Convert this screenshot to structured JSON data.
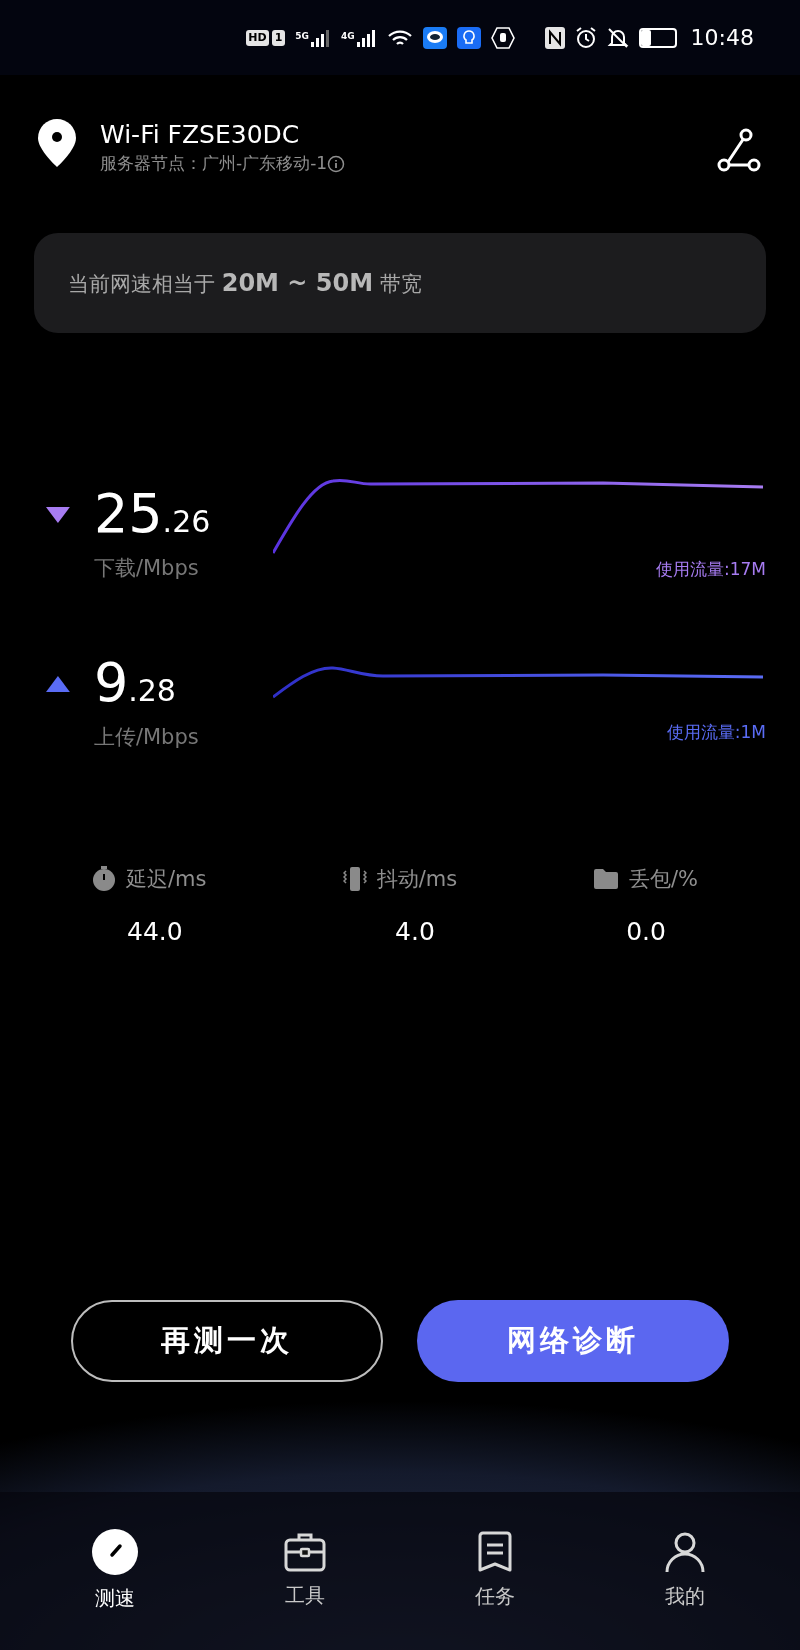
{
  "status_bar": {
    "hd": "HD",
    "sim": "1",
    "net1": "5G",
    "net2": "4G",
    "time": "10:48",
    "battery": {
      "level": 0.3
    }
  },
  "header": {
    "title": "Wi-Fi FZSE30DC",
    "subtitle": "服务器节点：广州-广东移动-1"
  },
  "bandwidth_card": {
    "text": "当前网速相当于 **20M ~ 50M** 带宽"
  },
  "speeds": [
    {
      "kind": "download",
      "int": "25",
      "dec": ".26",
      "unit": "下载/Mbps",
      "usage": "使用流量:17M",
      "color": "#a77cf2"
    },
    {
      "kind": "upload",
      "int": "9",
      "dec": ".28",
      "unit": "上传/Mbps",
      "usage": "使用流量:1M",
      "color": "#5a6cf5"
    }
  ],
  "stats": [
    {
      "kind": "latency",
      "label": "延迟/ms",
      "value": "44.0"
    },
    {
      "kind": "jitter",
      "label": "抖动/ms",
      "value": "4.0"
    },
    {
      "kind": "loss",
      "label": "丢包/%",
      "value": "0.0"
    }
  ],
  "buttons": [
    {
      "kind": "outline",
      "label": "再测一次"
    },
    {
      "kind": "primary",
      "label": "网络诊断"
    }
  ],
  "nav": [
    {
      "kind": "speed",
      "label": "测速",
      "selected": true
    },
    {
      "kind": "tools",
      "label": "工具",
      "selected": false
    },
    {
      "kind": "tasks",
      "label": "任务",
      "selected": false
    },
    {
      "kind": "me",
      "label": "我的",
      "selected": false
    }
  ]
}
